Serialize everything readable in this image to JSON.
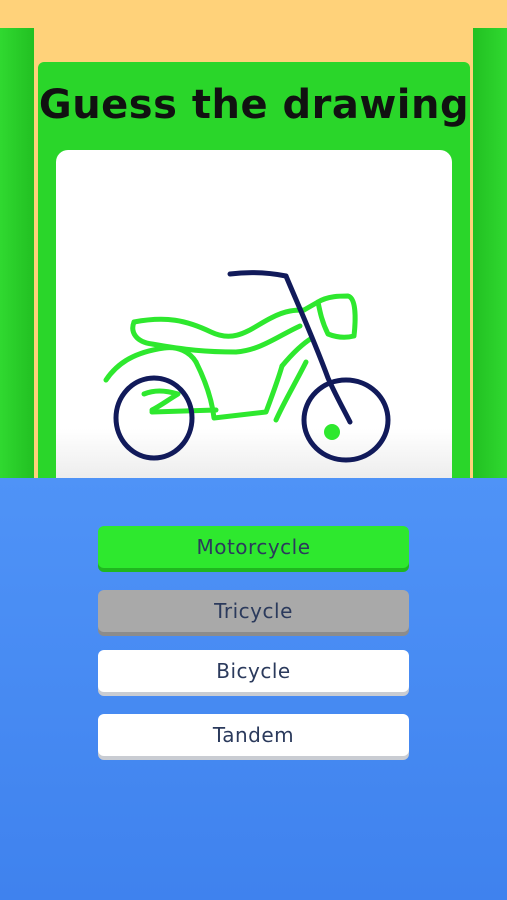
{
  "title": "Guess the drawing",
  "drawing": {
    "subject_icon": "motorcycle-drawing",
    "stroke_colors": {
      "body": "#2ee82e",
      "frame": "#111a5a"
    }
  },
  "answers": [
    {
      "label": "Motorcycle",
      "state": "correct"
    },
    {
      "label": "Tricycle",
      "state": "wrong"
    },
    {
      "label": "Bicycle",
      "state": "neutral"
    },
    {
      "label": "Tandem",
      "state": "neutral"
    }
  ],
  "colors": {
    "background_top": "#ffd27a",
    "board": "#2ad62a",
    "bottom": "#4f93f7",
    "correct": "#2ee82e",
    "wrong": "#a9a9a9",
    "neutral": "#ffffff",
    "answer_text": "#2b3a5c"
  }
}
